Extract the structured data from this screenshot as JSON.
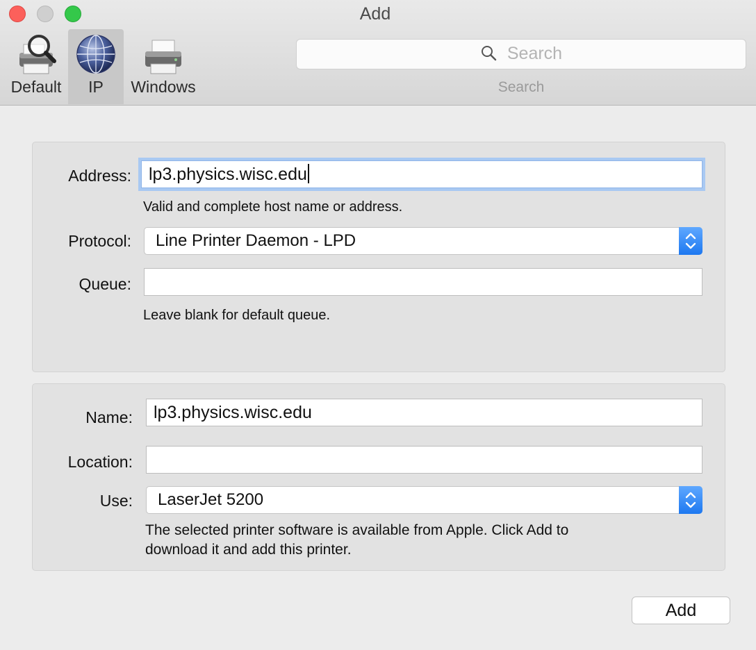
{
  "window": {
    "title": "Add"
  },
  "toolbar": {
    "items": [
      {
        "label": "Default",
        "icon": "default-printer-magnifier-icon"
      },
      {
        "label": "IP",
        "icon": "ip-globe-icon",
        "selected": true
      },
      {
        "label": "Windows",
        "icon": "windows-printer-icon"
      }
    ],
    "search": {
      "placeholder": "Search",
      "caption": "Search"
    }
  },
  "network": {
    "address_label": "Address:",
    "address_value": "lp3.physics.wisc.edu",
    "address_hint": "Valid and complete host name or address.",
    "protocol_label": "Protocol:",
    "protocol_value": "Line Printer Daemon - LPD",
    "queue_label": "Queue:",
    "queue_value": "",
    "queue_hint": "Leave blank for default queue."
  },
  "printer": {
    "name_label": "Name:",
    "name_value": "lp3.physics.wisc.edu",
    "location_label": "Location:",
    "location_value": "",
    "use_label": "Use:",
    "use_value": "LaserJet 5200",
    "use_hint_line1": "The selected printer software is available from Apple. Click Add to",
    "use_hint_line2": "download it and add this printer."
  },
  "actions": {
    "add_label": "Add"
  },
  "colors": {
    "close": "#fc605b",
    "zoom": "#34c84a",
    "accent": "#1d78f0",
    "focus_ring": "#a9c9f2"
  }
}
